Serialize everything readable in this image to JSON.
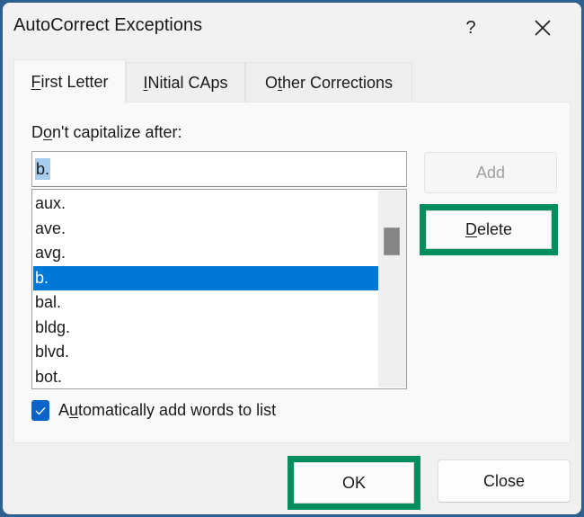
{
  "window": {
    "title": "AutoCorrect Exceptions",
    "help_label": "?",
    "close_icon": "close-icon"
  },
  "tabs": [
    {
      "label_pre": "",
      "mnemonic": "F",
      "label_post": "irst Letter",
      "active": true
    },
    {
      "label_pre": "",
      "mnemonic": "I",
      "label_post": "Nitial CAps",
      "active": false
    },
    {
      "label_pre": "O",
      "mnemonic": "t",
      "label_post": "her Corrections",
      "active": false
    }
  ],
  "first_letter": {
    "label_pre": "D",
    "label_mnemonic": "o",
    "label_post": "n't capitalize after:",
    "input_value": "b.",
    "list_items": [
      "aux.",
      "ave.",
      "avg.",
      "b.",
      "bal.",
      "bldg.",
      "blvd.",
      "bot."
    ],
    "selected_item": "b.",
    "scroll_position": 0.06,
    "add_label": "Add",
    "delete_mnemonic": "D",
    "delete_label_post": "elete",
    "auto_add": {
      "checked": true,
      "label_pre": "A",
      "mnemonic": "u",
      "label_post": "tomatically add words to list"
    }
  },
  "footer": {
    "ok_label": "OK",
    "close_label": "Close"
  },
  "colors": {
    "highlight_frame": "#038f5d",
    "selection": "#0078d7",
    "checkbox": "#0a64c8"
  }
}
